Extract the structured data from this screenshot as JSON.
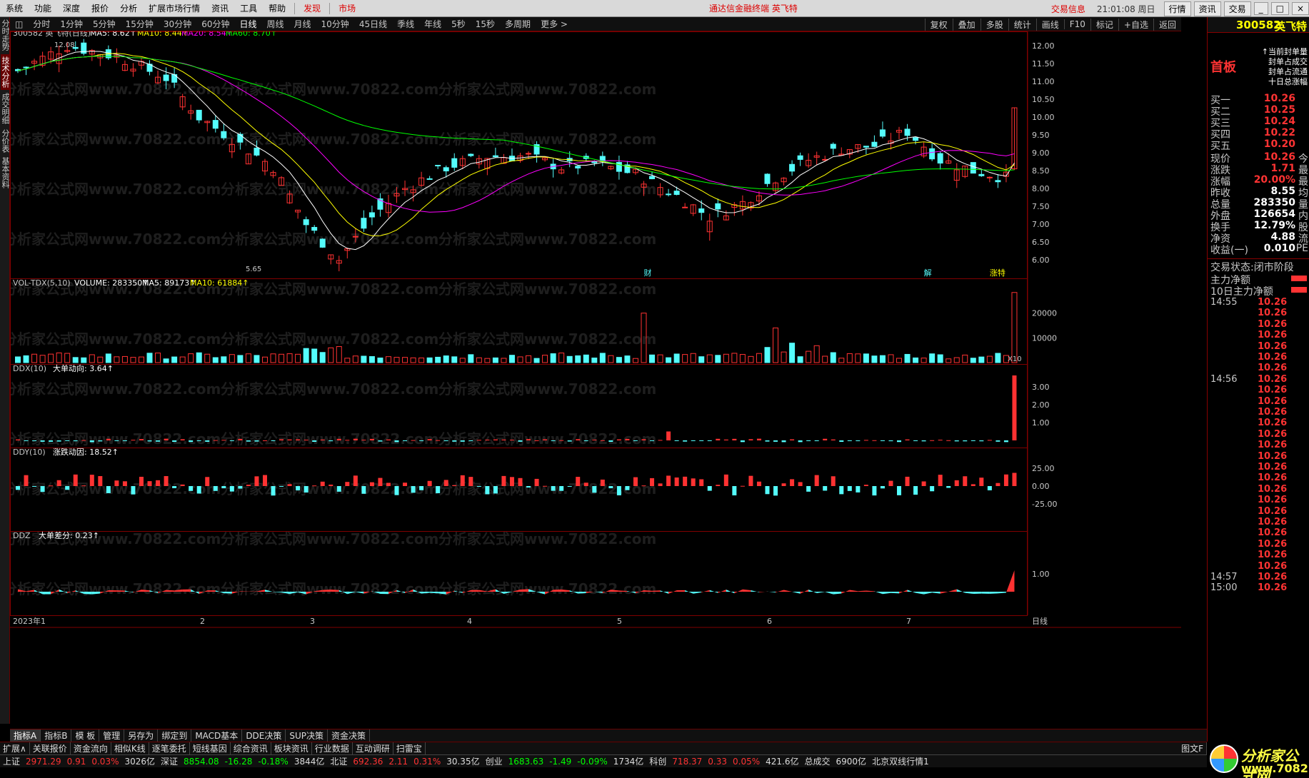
{
  "menu": {
    "items": [
      "系统",
      "功能",
      "深度",
      "报价",
      "分析",
      "扩展市场行情",
      "资讯",
      "工具",
      "帮助"
    ],
    "red_items": [
      "发现",
      "市场"
    ],
    "headline": "通达信金融终端  英飞特",
    "trade": "交易信息",
    "clock": "21:01:08 周日",
    "buttons": [
      "行情",
      "资讯",
      "交易"
    ]
  },
  "timebar": {
    "items": [
      "分时",
      "1分钟",
      "5分钟",
      "15分钟",
      "30分钟",
      "60分钟",
      "日线",
      "周线",
      "月线",
      "10分钟",
      "45日线",
      "季线",
      "年线",
      "5秒",
      "15秒",
      "多周期",
      "更多 >"
    ],
    "right": [
      "复权",
      "叠加",
      "多股",
      "统计",
      "画线",
      "F10",
      "标记",
      "+自选",
      "返回"
    ]
  },
  "vtabs": [
    "分时走势",
    "技术分析",
    "成交明细",
    "分价表",
    "基本资料"
  ],
  "main": {
    "code_title": "300582 英飞特(日线)",
    "ma5": "MA5: 8.62↑",
    "ma10": "MA10: 8.44↑",
    "ma20": "MA20: 8.54↑",
    "ma60": "MA60: 8.70↑",
    "high_note": "12.08",
    "low_note": "5.65",
    "y_ticks": [
      "12.00",
      "11.50",
      "11.00",
      "10.50",
      "10.00",
      "9.50",
      "9.00",
      "8.50",
      "8.00",
      "7.50",
      "7.00",
      "6.50",
      "6.00"
    ],
    "markers": [
      "财",
      "解",
      "涨特"
    ],
    "watermark": "分析家公式网www.70822.com"
  },
  "vol": {
    "title": "VOL-TDX(5,10)",
    "volume": "VOLUME: 283350↑",
    "ma5": "MA5: 89173↑",
    "ma10": "MA10: 61884↑",
    "ticks": [
      "20000",
      "10000"
    ],
    "unit": "X10"
  },
  "ddx": {
    "title": "DDX(10)",
    "label": "大单动向: 3.64↑",
    "ticks": [
      "3.00",
      "2.00",
      "1.00"
    ]
  },
  "ddy": {
    "title": "DDY(10)",
    "label": "涨跌动因: 18.52↑",
    "ticks": [
      "25.00",
      "0.00",
      "-25.00"
    ]
  },
  "ddz": {
    "title": "DDZ",
    "label": "大单差分: 0.23↑",
    "ticks": [
      "1.00"
    ]
  },
  "xaxis": {
    "labels": [
      "2023年1",
      "2",
      "3",
      "4",
      "5",
      "6",
      "7"
    ],
    "right": "日线"
  },
  "colors": {
    "up": "#ff3232",
    "down": "#54fcfc",
    "ma5": "#ffffff",
    "ma10": "#ffff00",
    "ma20": "#ff00ff",
    "ma60": "#00ff00",
    "grid": "#800000"
  },
  "quote": {
    "code": "300582",
    "name": "英飞特",
    "board": "首板",
    "notes": [
      "↑当前封单量",
      "封单占成交",
      "封单占流通",
      "十日总涨幅"
    ],
    "book": [
      {
        "l": "买一",
        "v": "10.26",
        "n": ""
      },
      {
        "l": "买二",
        "v": "10.25",
        "n": ""
      },
      {
        "l": "买三",
        "v": "10.24",
        "n": ""
      },
      {
        "l": "买四",
        "v": "10.22",
        "n": ""
      },
      {
        "l": "买五",
        "v": "10.20",
        "n": ""
      }
    ],
    "stats": [
      {
        "l": "现价",
        "v": "10.26",
        "s": "今"
      },
      {
        "l": "涨跌",
        "v": "1.71",
        "s": "最"
      },
      {
        "l": "涨幅",
        "v": "20.00%",
        "s": "最"
      },
      {
        "l": "昨收",
        "v": "8.55",
        "s": "均"
      },
      {
        "l": "总量",
        "v": "283350",
        "s": "量"
      },
      {
        "l": "外盘",
        "v": "126654",
        "s": "内"
      },
      {
        "l": "换手",
        "v": "12.79%",
        "s": "股"
      },
      {
        "l": "净资",
        "v": "4.88",
        "s": "流"
      },
      {
        "l": "收益(一)",
        "v": "0.010",
        "s": "PE"
      }
    ],
    "status": "交易状态:闭市阶段",
    "flow": [
      "主力净额",
      "10日主力净额"
    ],
    "ticks": [
      {
        "t": "14:55",
        "p": "10.26"
      },
      {
        "t": "",
        "p": "10.26"
      },
      {
        "t": "",
        "p": "10.26"
      },
      {
        "t": "",
        "p": "10.26"
      },
      {
        "t": "",
        "p": "10.26"
      },
      {
        "t": "",
        "p": "10.26"
      },
      {
        "t": "",
        "p": "10.26"
      },
      {
        "t": "14:56",
        "p": "10.26"
      },
      {
        "t": "",
        "p": "10.26"
      },
      {
        "t": "",
        "p": "10.26"
      },
      {
        "t": "",
        "p": "10.26"
      },
      {
        "t": "",
        "p": "10.26"
      },
      {
        "t": "",
        "p": "10.26"
      },
      {
        "t": "",
        "p": "10.26"
      },
      {
        "t": "",
        "p": "10.26"
      },
      {
        "t": "",
        "p": "10.26"
      },
      {
        "t": "",
        "p": "10.26"
      },
      {
        "t": "",
        "p": "10.26"
      },
      {
        "t": "",
        "p": "10.26"
      },
      {
        "t": "",
        "p": "10.26"
      },
      {
        "t": "",
        "p": "10.26"
      },
      {
        "t": "",
        "p": "10.26"
      },
      {
        "t": "",
        "p": "10.26"
      },
      {
        "t": "",
        "p": "10.26"
      },
      {
        "t": "",
        "p": "10.26"
      },
      {
        "t": "14:57",
        "p": "10.26"
      },
      {
        "t": "15:00",
        "p": "10.26"
      }
    ]
  },
  "bottom_tabs": [
    "指标A",
    "指标B",
    "模 板",
    "管理",
    "另存为",
    "绑定到",
    "MACD基本",
    "DDE决策",
    "SUP决策",
    "资金决策"
  ],
  "info_tabs": [
    "扩展∧",
    "关联报价",
    "资金流向",
    "相似K线",
    "逐笔委托",
    "短线基因",
    "综合资讯",
    "板块资讯",
    "行业数据",
    "互动调研",
    "扫雷宝"
  ],
  "info_right": "图文F",
  "status": [
    {
      "t": "上证",
      "c": "wh"
    },
    {
      "t": "2971.29",
      "c": "rd"
    },
    {
      "t": "0.91",
      "c": "rd"
    },
    {
      "t": "0.03%",
      "c": "rd"
    },
    {
      "t": "3026亿",
      "c": "wh"
    },
    {
      "t": "深证",
      "c": "wh"
    },
    {
      "t": "8854.08",
      "c": "gr"
    },
    {
      "t": "-16.28",
      "c": "gr"
    },
    {
      "t": "-0.18%",
      "c": "gr"
    },
    {
      "t": "3844亿",
      "c": "wh"
    },
    {
      "t": "北证",
      "c": "wh"
    },
    {
      "t": "692.36",
      "c": "rd"
    },
    {
      "t": "2.11",
      "c": "rd"
    },
    {
      "t": "0.31%",
      "c": "rd"
    },
    {
      "t": "30.35亿",
      "c": "wh"
    },
    {
      "t": "创业",
      "c": "wh"
    },
    {
      "t": "1683.63",
      "c": "gr"
    },
    {
      "t": "-1.49",
      "c": "gr"
    },
    {
      "t": "-0.09%",
      "c": "gr"
    },
    {
      "t": "1734亿",
      "c": "wh"
    },
    {
      "t": "科创",
      "c": "wh"
    },
    {
      "t": "718.37",
      "c": "rd"
    },
    {
      "t": "0.33",
      "c": "rd"
    },
    {
      "t": "0.05%",
      "c": "rd"
    },
    {
      "t": "421.6亿",
      "c": "wh"
    },
    {
      "t": "总成交",
      "c": "wh"
    },
    {
      "t": "6900亿",
      "c": "wh"
    },
    {
      "t": "北京双线行情1",
      "c": "wh"
    }
  ],
  "logo": {
    "l1": "分析家公式网",
    "l2": "www.70822.com"
  }
}
